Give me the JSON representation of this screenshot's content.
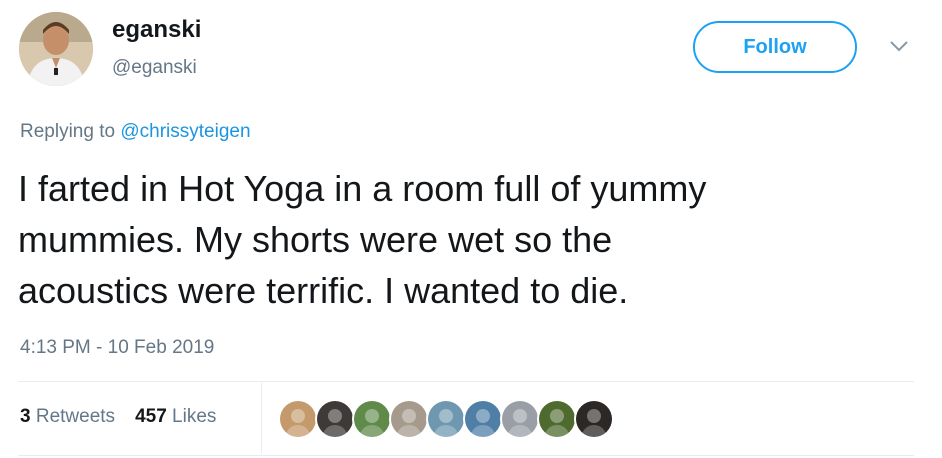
{
  "author": {
    "display_name": "eganski",
    "handle": "@eganski"
  },
  "follow": {
    "label": "Follow"
  },
  "reply": {
    "prefix": "Replying to",
    "mention": "@chrissyteigen"
  },
  "tweet": {
    "lines": [
      "I farted in Hot Yoga in a room full of yummy",
      "mummies. My shorts were wet so the",
      "acoustics were terrific. I wanted to die."
    ]
  },
  "timestamp": "4:13 PM - 10 Feb 2019",
  "stats": {
    "retweets_count": "3",
    "retweets_label": "Retweets",
    "likes_count": "457",
    "likes_label": "Likes"
  },
  "likers": [
    {
      "icon": "dog-avatar",
      "color": "#c49a6c"
    },
    {
      "icon": "person-avatar",
      "color": "#3d3a38"
    },
    {
      "icon": "outdoor-avatar",
      "color": "#5f8a4a"
    },
    {
      "icon": "person-avatar",
      "color": "#a69a8c"
    },
    {
      "icon": "person-avatar",
      "color": "#6f98b0"
    },
    {
      "icon": "person-avatar",
      "color": "#4f7fa6"
    },
    {
      "icon": "person-avatar",
      "color": "#9a9ea6"
    },
    {
      "icon": "stadium-avatar",
      "color": "#4e6a2e"
    },
    {
      "icon": "person-avatar",
      "color": "#2b2826"
    }
  ],
  "colors": {
    "accent": "#1da1f2",
    "link": "#1b95e0",
    "secondary_text": "#657786",
    "primary_text": "#14171a",
    "divider": "#e6ecf0"
  }
}
